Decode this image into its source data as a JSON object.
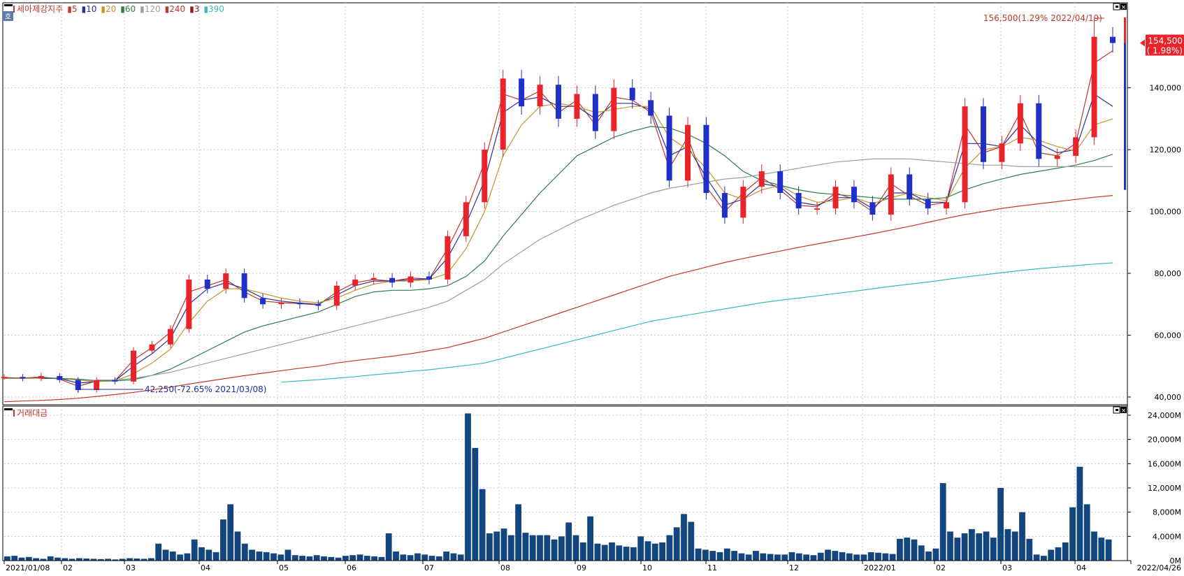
{
  "price_panel": {
    "legend": {
      "stock_name": "세아제강지주",
      "items": [
        {
          "label": "5",
          "color": "#c0392b"
        },
        {
          "label": "10",
          "color": "#2a2fa0"
        },
        {
          "label": "20",
          "color": "#c8922a"
        },
        {
          "label": "60",
          "color": "#2e7d4f"
        },
        {
          "label": "120",
          "color": "#9e9e9e"
        },
        {
          "label": "240",
          "color": "#c0392b"
        },
        {
          "label": "3",
          "color": "#8e1f1f"
        },
        {
          "label": "390",
          "color": "#39b8c0"
        }
      ]
    },
    "panel_icon": "호",
    "high_annotation": "156,500(1.29% 2022/04/19)",
    "low_annotation": "42,250(-72.65% 2021/03/08)",
    "last_price": "154,500",
    "last_change": "( 1.98%)",
    "colors": {
      "up": "#e8232a",
      "down": "#1f2fc8",
      "last_tag": "#e8232a"
    }
  },
  "volume_panel": {
    "legend_label": "거래대금",
    "color": "#13467f"
  },
  "x_axis": {
    "labels": [
      "2021/01/08",
      "02",
      "03",
      "04",
      "05",
      "06",
      "07",
      "08",
      "09",
      "10",
      "11",
      "12",
      "2022/01",
      "02",
      "03",
      "04",
      "2022/04/26"
    ]
  },
  "chart_data": [
    {
      "type": "line",
      "title": "",
      "xlabel": "",
      "ylabel": "",
      "ylim": [
        37500,
        167500
      ],
      "y_ticks": [
        "40,000",
        "60,000",
        "80,000",
        "100,000",
        "120,000",
        "140,000"
      ],
      "candles": {
        "desc": "daily price points (approx. close)",
        "dates": [
          "2021/01/08",
          "2021/01/22",
          "2021/02/05",
          "2021/02/19",
          "2021/03/08",
          "2021/03/22",
          "2021/04/02",
          "2021/04/09",
          "2021/04/16",
          "2021/04/23",
          "2021/04/29",
          "2021/05/06",
          "2021/05/13",
          "2021/05/20",
          "2021/05/27",
          "2021/06/03",
          "2021/06/17",
          "2021/06/28",
          "2021/07/08",
          "2021/07/15",
          "2021/07/23",
          "2021/07/30",
          "2021/08/06",
          "2021/08/12",
          "2021/08/17",
          "2021/08/24",
          "2021/08/31",
          "2021/09/03",
          "2021/09/10",
          "2021/09/17",
          "2021/09/27",
          "2021/10/05",
          "2021/10/12",
          "2021/10/19",
          "2021/10/26",
          "2021/11/02",
          "2021/11/09",
          "2021/11/16",
          "2021/11/23",
          "2021/12/01",
          "2021/12/08",
          "2021/12/15",
          "2021/12/22",
          "2021/12/29",
          "2022/01/05",
          "2022/01/12",
          "2022/01/19",
          "2022/01/26",
          "2022/02/03",
          "2022/02/10",
          "2022/02/17",
          "2022/02/24",
          "2022/03/03",
          "2022/03/10",
          "2022/03/17",
          "2022/03/24",
          "2022/03/31",
          "2022/04/07",
          "2022/04/14",
          "2022/04/19",
          "2022/04/26"
        ],
        "values": [
          46500,
          46000,
          46800,
          45500,
          42250,
          45500,
          45000,
          55000,
          57000,
          62000,
          78000,
          75000,
          80000,
          72000,
          70000,
          70500,
          70000,
          69500,
          76000,
          78000,
          78500,
          77000,
          79000,
          78000,
          92000,
          103000,
          120000,
          143000,
          134000,
          141000,
          130000,
          138000,
          126000,
          140000,
          136000,
          131000,
          110000,
          128000,
          106000,
          98000,
          108000,
          113000,
          106000,
          101000,
          101000,
          108000,
          103000,
          99000,
          112000,
          104000,
          101000,
          103000,
          134000,
          116000,
          122000,
          135000,
          117000,
          118000,
          124000,
          156500,
          154500
        ]
      },
      "series": [
        {
          "name": "5",
          "values": [
            46300,
            46100,
            46500,
            45800,
            43500,
            45200,
            45300,
            52000,
            56000,
            61000,
            74000,
            76000,
            78000,
            74000,
            71000,
            70500,
            70200,
            69800,
            74000,
            77000,
            78000,
            77500,
            78500,
            78200,
            88000,
            100000,
            116000,
            138000,
            136000,
            139000,
            132000,
            136000,
            128000,
            137000,
            136000,
            132000,
            114000,
            124000,
            108000,
            100000,
            106000,
            111000,
            107000,
            102000,
            101500,
            106000,
            104000,
            100000,
            109000,
            105000,
            102000,
            103000,
            128000,
            119000,
            121000,
            132000,
            119000,
            118000,
            122000,
            148000,
            152000
          ]
        },
        {
          "name": "10",
          "values": [
            46200,
            46100,
            46300,
            46000,
            44500,
            45000,
            45300,
            50000,
            54000,
            59000,
            70000,
            75000,
            77000,
            75000,
            72000,
            71000,
            70400,
            70000,
            73000,
            76000,
            77500,
            77500,
            78000,
            78200,
            85000,
            96000,
            110000,
            132000,
            136000,
            137000,
            134000,
            134000,
            130000,
            135000,
            135000,
            133000,
            118000,
            121000,
            111000,
            102000,
            104000,
            109000,
            108000,
            103000,
            102000,
            104500,
            104500,
            101000,
            106000,
            106000,
            103000,
            103000,
            122000,
            122000,
            121000,
            128000,
            122000,
            119000,
            120000,
            138000,
            134000
          ]
        },
        {
          "name": "20",
          "values": [
            46000,
            46000,
            46100,
            46000,
            45500,
            45000,
            45200,
            47500,
            51000,
            55500,
            64000,
            71000,
            75000,
            75000,
            73500,
            72000,
            71000,
            70500,
            72000,
            74500,
            76500,
            77500,
            77500,
            78000,
            80000,
            88000,
            100000,
            118000,
            128000,
            134000,
            135000,
            134000,
            132000,
            133000,
            134000,
            134000,
            124000,
            120000,
            114000,
            106000,
            104000,
            107000,
            108500,
            105000,
            103000,
            103500,
            104500,
            102500,
            104500,
            106000,
            104500,
            103500,
            114000,
            120000,
            121000,
            124000,
            123000,
            121000,
            119500,
            128000,
            130000
          ]
        },
        {
          "name": "60",
          "values": [
            null,
            null,
            46000,
            46000,
            45800,
            45300,
            45200,
            45600,
            47000,
            49000,
            52000,
            55000,
            58000,
            61000,
            63000,
            64500,
            66000,
            67500,
            70000,
            72500,
            74000,
            74500,
            74500,
            75000,
            76000,
            79000,
            84000,
            92000,
            99000,
            106000,
            112000,
            118000,
            121000,
            124000,
            126000,
            127500,
            127000,
            125000,
            122000,
            118000,
            113000,
            110000,
            108500,
            107000,
            106000,
            105500,
            105000,
            104500,
            104000,
            104000,
            104000,
            104500,
            107000,
            109000,
            110500,
            112000,
            113000,
            114000,
            115000,
            116500,
            118500
          ]
        },
        {
          "name": "120",
          "values": [
            null,
            null,
            null,
            null,
            null,
            45500,
            45500,
            46000,
            47000,
            48000,
            49500,
            51000,
            52500,
            54000,
            55500,
            57000,
            58500,
            60000,
            61500,
            63000,
            64500,
            66000,
            67500,
            69000,
            71000,
            74500,
            78000,
            83000,
            87000,
            91000,
            94000,
            97000,
            99500,
            102000,
            104000,
            106000,
            107500,
            108500,
            109500,
            110500,
            111000,
            112000,
            113000,
            114000,
            115000,
            116000,
            116500,
            117000,
            117000,
            117000,
            116500,
            116000,
            115500,
            115000,
            115000,
            114500,
            114500,
            114500,
            114500,
            114500,
            114500
          ]
        },
        {
          "name": "240",
          "values": [
            38500,
            38700,
            38900,
            39200,
            39600,
            40200,
            40800,
            41500,
            42300,
            43200,
            44200,
            45100,
            46000,
            46900,
            47700,
            48500,
            49300,
            50000,
            51000,
            51800,
            52500,
            53200,
            54000,
            55000,
            56000,
            57500,
            59000,
            61000,
            63000,
            65000,
            67000,
            69000,
            71000,
            73000,
            75000,
            77000,
            79000,
            80500,
            82000,
            83500,
            84800,
            86000,
            87200,
            88400,
            89500,
            90600,
            91700,
            92800,
            94000,
            95200,
            96500,
            97800,
            99000,
            100000,
            101000,
            101800,
            102500,
            103200,
            103900,
            104600,
            105200
          ]
        },
        {
          "name": "390",
          "values": [
            null,
            null,
            null,
            null,
            null,
            null,
            null,
            null,
            null,
            null,
            null,
            null,
            null,
            null,
            null,
            44800,
            45200,
            45600,
            46100,
            46600,
            47200,
            47700,
            48300,
            48800,
            49500,
            50200,
            51000,
            52500,
            54000,
            55500,
            57000,
            58500,
            60000,
            61500,
            63000,
            64500,
            65500,
            66500,
            67500,
            68500,
            69500,
            70500,
            71300,
            72000,
            72700,
            73500,
            74200,
            75000,
            75800,
            76500,
            77200,
            78000,
            78800,
            79500,
            80200,
            80900,
            81500,
            82000,
            82500,
            83000,
            83400
          ]
        }
      ]
    },
    {
      "type": "bar",
      "title": "",
      "xlabel": "",
      "ylabel": "거래대금",
      "ylim": [
        0,
        25500
      ],
      "y_ticks": [
        "0M",
        "4,000M",
        "8,000M",
        "12,000M",
        "16,000M",
        "20,000M",
        "24,000M"
      ],
      "values": [
        700,
        800,
        500,
        600,
        400,
        300,
        700,
        500,
        400,
        300,
        400,
        350,
        300,
        250,
        300,
        200,
        300,
        400,
        350,
        300,
        400,
        2800,
        1800,
        1500,
        1000,
        1200,
        3500,
        2200,
        1800,
        1400,
        6800,
        9300,
        4800,
        2800,
        1800,
        1500,
        1400,
        1200,
        1000,
        1800,
        900,
        800,
        700,
        900,
        700,
        600,
        500,
        800,
        900,
        1000,
        800,
        700,
        600,
        4500,
        1500,
        1000,
        900,
        1200,
        1000,
        800,
        700,
        1500,
        1200,
        1000,
        24300,
        18600,
        11800,
        4500,
        4800,
        5300,
        4200,
        9300,
        4600,
        4200,
        4200,
        4200,
        3500,
        4000,
        6300,
        4200,
        3000,
        7300,
        2800,
        2600,
        3000,
        2500,
        2300,
        2200,
        4000,
        3200,
        2800,
        3000,
        4200,
        5500,
        7700,
        6400,
        2000,
        1800,
        1600,
        1400,
        2000,
        1600,
        1200,
        1000,
        1600,
        1200,
        1100,
        1000,
        1000,
        1400,
        1200,
        1000,
        900,
        1300,
        1800,
        1600,
        1400,
        1200,
        1000,
        1000,
        1400,
        1300,
        1200,
        1100,
        3600,
        3800,
        3500,
        2500,
        1500,
        2000,
        12800,
        4800,
        3800,
        4500,
        5200,
        4500,
        4800,
        3800,
        12000,
        5200,
        4800,
        8000,
        3600,
        1000,
        800,
        1800,
        2200,
        3000,
        8800,
        15500,
        9300,
        4800,
        3800,
        3500
      ]
    }
  ]
}
